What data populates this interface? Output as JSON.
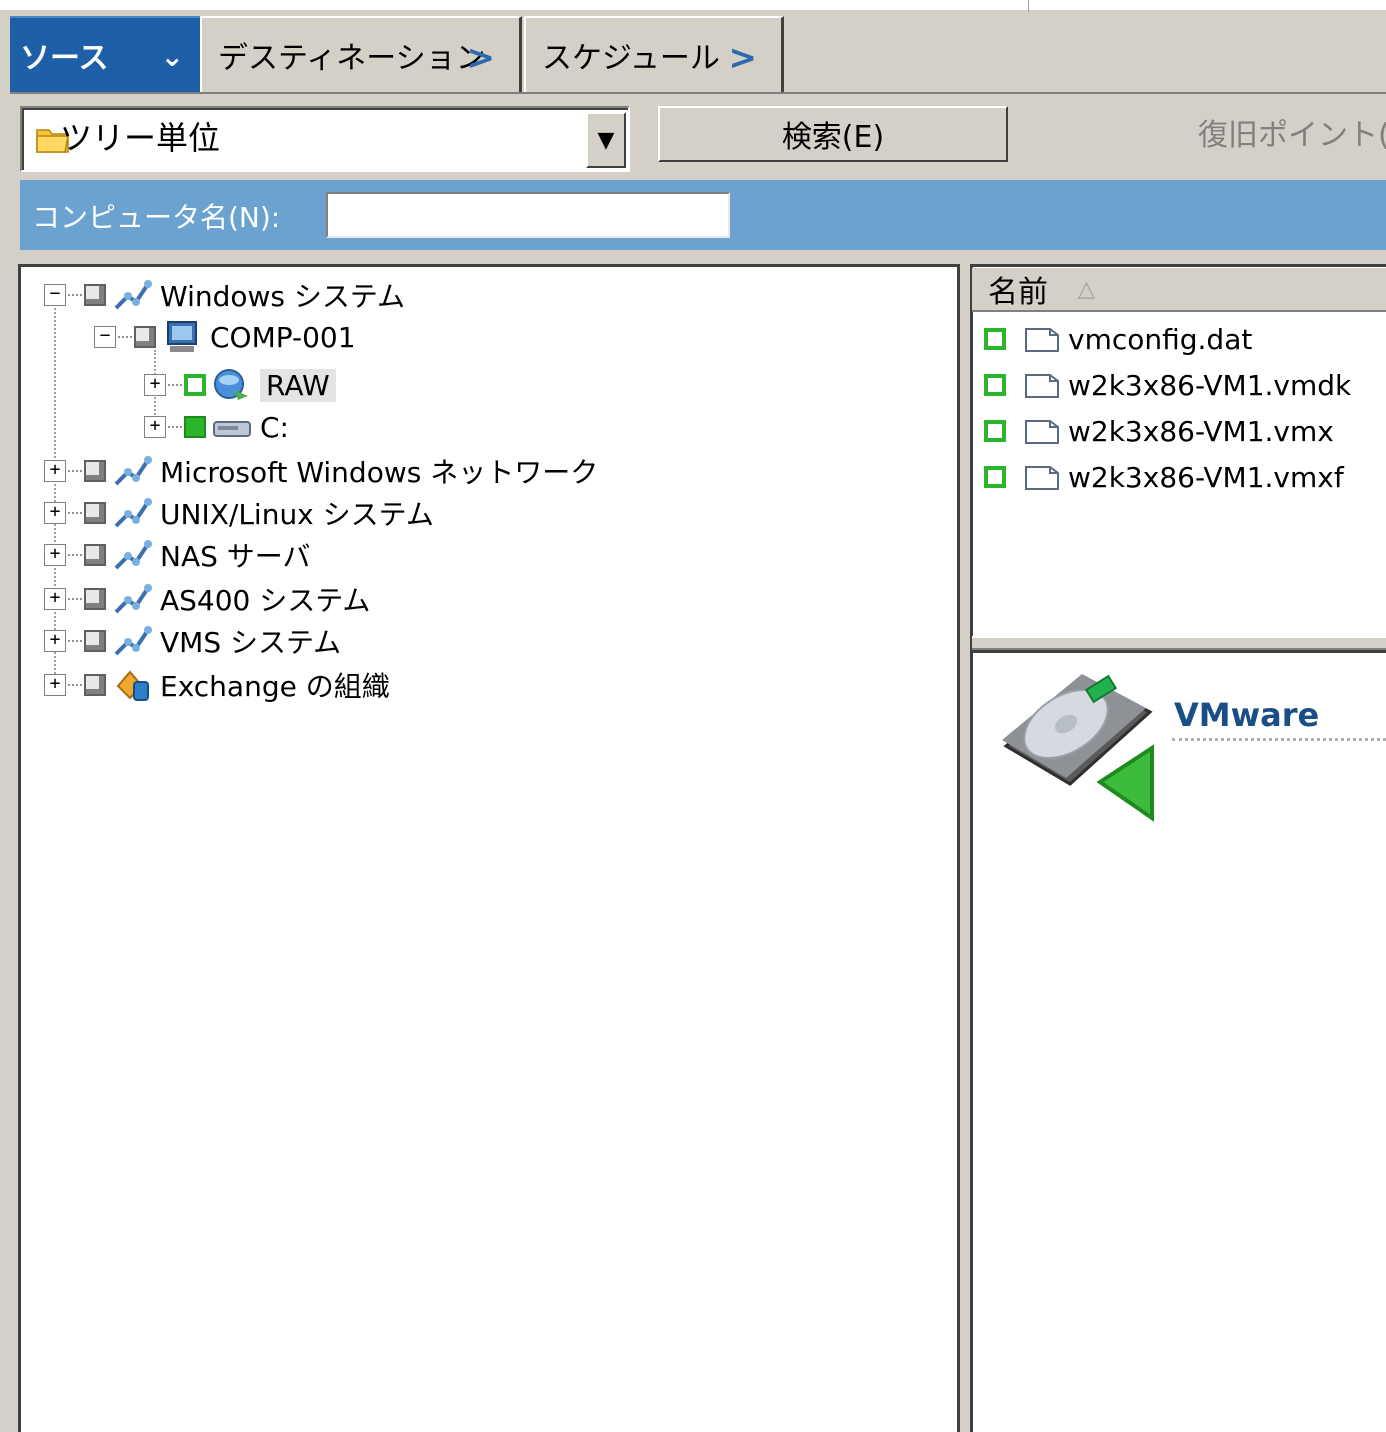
{
  "tabs": [
    {
      "label": "ソース",
      "arrow": "⌄"
    },
    {
      "label": "デスティネーション",
      "arrow": ">"
    },
    {
      "label": "スケジュール",
      "arrow": ">"
    }
  ],
  "view_combo": {
    "value": "ツリー単位",
    "dropdown_glyph": "▼"
  },
  "search_button": {
    "label": "検索(E)"
  },
  "recovery_point_label": "復旧ポイント(F",
  "filter": {
    "label": "コンピュータ名(N):",
    "value": ""
  },
  "tree": {
    "nodes": [
      {
        "label": "Windows システム",
        "expander": "−",
        "check": "gray",
        "icon": "network-icon",
        "level": 0
      },
      {
        "label": "COMP-001",
        "expander": "−",
        "check": "gray",
        "icon": "computer-icon",
        "level": 1
      },
      {
        "label": "RAW",
        "expander": "+",
        "check": "partial-g",
        "icon": "raw-disk-icon",
        "level": 2,
        "selected": true
      },
      {
        "label": "C:",
        "expander": "+",
        "check": "full-g",
        "icon": "drive-icon",
        "level": 2
      },
      {
        "label": "Microsoft Windows ネットワーク",
        "expander": "+",
        "check": "gray",
        "icon": "network-icon",
        "level": 0
      },
      {
        "label": "UNIX/Linux システム",
        "expander": "+",
        "check": "gray",
        "icon": "network-icon",
        "level": 0
      },
      {
        "label": "NAS サーバ",
        "expander": "+",
        "check": "gray",
        "icon": "network-icon",
        "level": 0
      },
      {
        "label": "AS400 システム",
        "expander": "+",
        "check": "gray",
        "icon": "network-icon",
        "level": 0
      },
      {
        "label": "VMS システム",
        "expander": "+",
        "check": "gray",
        "icon": "network-icon",
        "level": 0
      },
      {
        "label": "Exchange の組織",
        "expander": "+",
        "check": "gray",
        "icon": "exchange-icon",
        "level": 0
      }
    ]
  },
  "file_list": {
    "header": "名前",
    "sort_glyph": "△",
    "files": [
      "vmconfig.dat",
      "w2k3x86-VM1.vmdk",
      "w2k3x86-VM1.vmx",
      "w2k3x86-VM1.vmxf"
    ]
  },
  "detail": {
    "title": "VMware"
  },
  "colors": {
    "tab_active": "#1f5fa7",
    "filter_bar": "#6ba2d0",
    "check_green": "#2bb52b",
    "vm_title": "#1a4f86"
  }
}
